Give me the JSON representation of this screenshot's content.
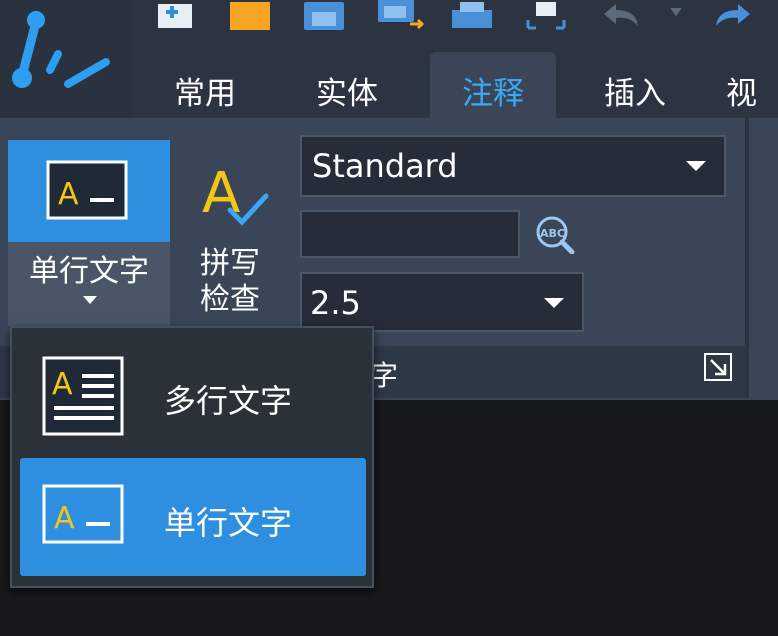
{
  "quick_access": {
    "icons": [
      "new-icon",
      "open-icon",
      "save-icon",
      "save-as-icon",
      "print-icon",
      "plot-icon",
      "undo-icon",
      "undo-dropdown-icon",
      "redo-icon"
    ]
  },
  "tabs": [
    {
      "label": "常用"
    },
    {
      "label": "实体"
    },
    {
      "label": "注释",
      "active": true
    },
    {
      "label": "插入"
    },
    {
      "label": "视"
    }
  ],
  "ribbon": {
    "single_line_button_label": "单行文字",
    "spell_check_label_line1": "拼写",
    "spell_check_label_line2": "检查",
    "style_combo_value": "Standard",
    "text_input_value": "",
    "height_combo_value": "2.5",
    "panel_title_fragment": "字"
  },
  "dropdown": {
    "items": [
      {
        "label": "多行文字",
        "icon": "multiline-text-icon"
      },
      {
        "label": "单行文字",
        "icon": "single-line-text-icon",
        "selected": true
      }
    ]
  },
  "colors": {
    "accent": "#2e8fe0",
    "active_tab_text": "#3ea7f5",
    "ribbon_bg": "#3a4658",
    "icon_yellow": "#f5c518"
  }
}
